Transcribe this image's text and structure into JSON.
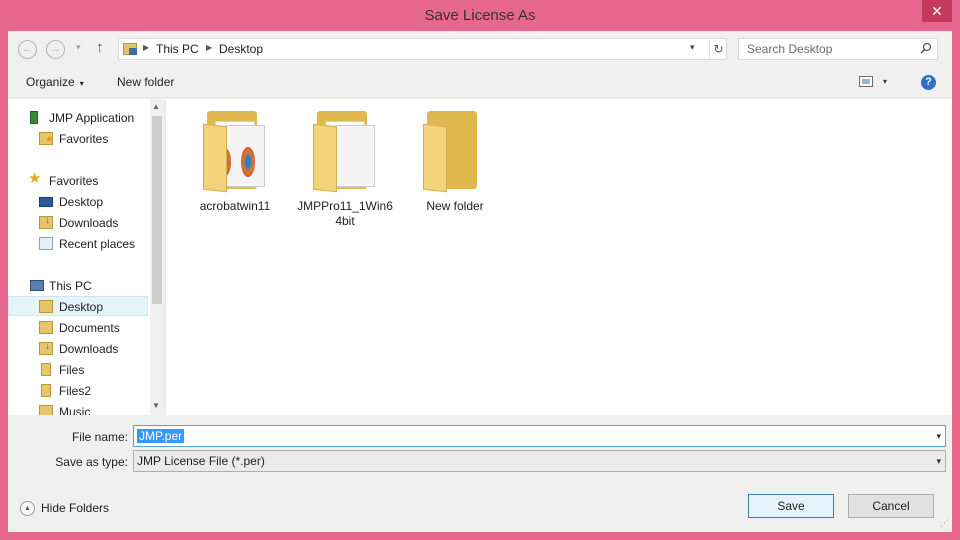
{
  "window": {
    "title": "Save License As",
    "close_glyph": "✕"
  },
  "nav": {
    "back_glyph": "←",
    "forward_glyph": "→",
    "recent_glyph": "▾",
    "up_glyph": "↑",
    "breadcrumb": [
      "This PC",
      "Desktop"
    ],
    "breadcrumb_sep": "▶",
    "address_dropdown_glyph": "▾",
    "refresh_glyph": "↻",
    "search_placeholder": "Search Desktop"
  },
  "toolbar": {
    "organize_label": "Organize",
    "caret": "▾",
    "new_folder_label": "New folder",
    "view_caret": "▾",
    "help_glyph": "?"
  },
  "sidebar": {
    "items": [
      {
        "label": "JMP Application",
        "icon": "app-icon"
      },
      {
        "label": "Favorites",
        "icon": "favorites-folder-icon"
      },
      {
        "label": "Favorites",
        "icon": "star-icon"
      },
      {
        "label": "Desktop",
        "icon": "desktop-icon"
      },
      {
        "label": "Downloads",
        "icon": "downloads-icon"
      },
      {
        "label": "Recent places",
        "icon": "recent-places-icon"
      },
      {
        "label": "This PC",
        "icon": "computer-icon"
      },
      {
        "label": "Desktop",
        "icon": "desktop-folder-icon",
        "selected": true
      },
      {
        "label": "Documents",
        "icon": "documents-icon"
      },
      {
        "label": "Downloads",
        "icon": "downloads-icon"
      },
      {
        "label": "Files",
        "icon": "files-icon"
      },
      {
        "label": "Files2",
        "icon": "files-icon"
      },
      {
        "label": "Music",
        "icon": "music-icon"
      }
    ],
    "scroll_up_glyph": "▲",
    "scroll_down_glyph": "▼"
  },
  "files": [
    {
      "name": "acrobatwin11",
      "icon": "folder-with-discs-icon"
    },
    {
      "name": "JMPPro11_1Win64bit",
      "icon": "folder-with-pages-icon"
    },
    {
      "name": "New folder",
      "icon": "empty-folder-icon"
    }
  ],
  "form": {
    "filename_label": "File name:",
    "filename_value": "JMP.per",
    "savetype_label": "Save as type:",
    "savetype_value": "JMP License File (*.per)",
    "dropdown_glyph": "▾"
  },
  "footer": {
    "hide_folders_label": "Hide Folders",
    "hide_folders_glyph": "▲",
    "save_label": "Save",
    "cancel_label": "Cancel",
    "resize_glyph": "⋰"
  }
}
